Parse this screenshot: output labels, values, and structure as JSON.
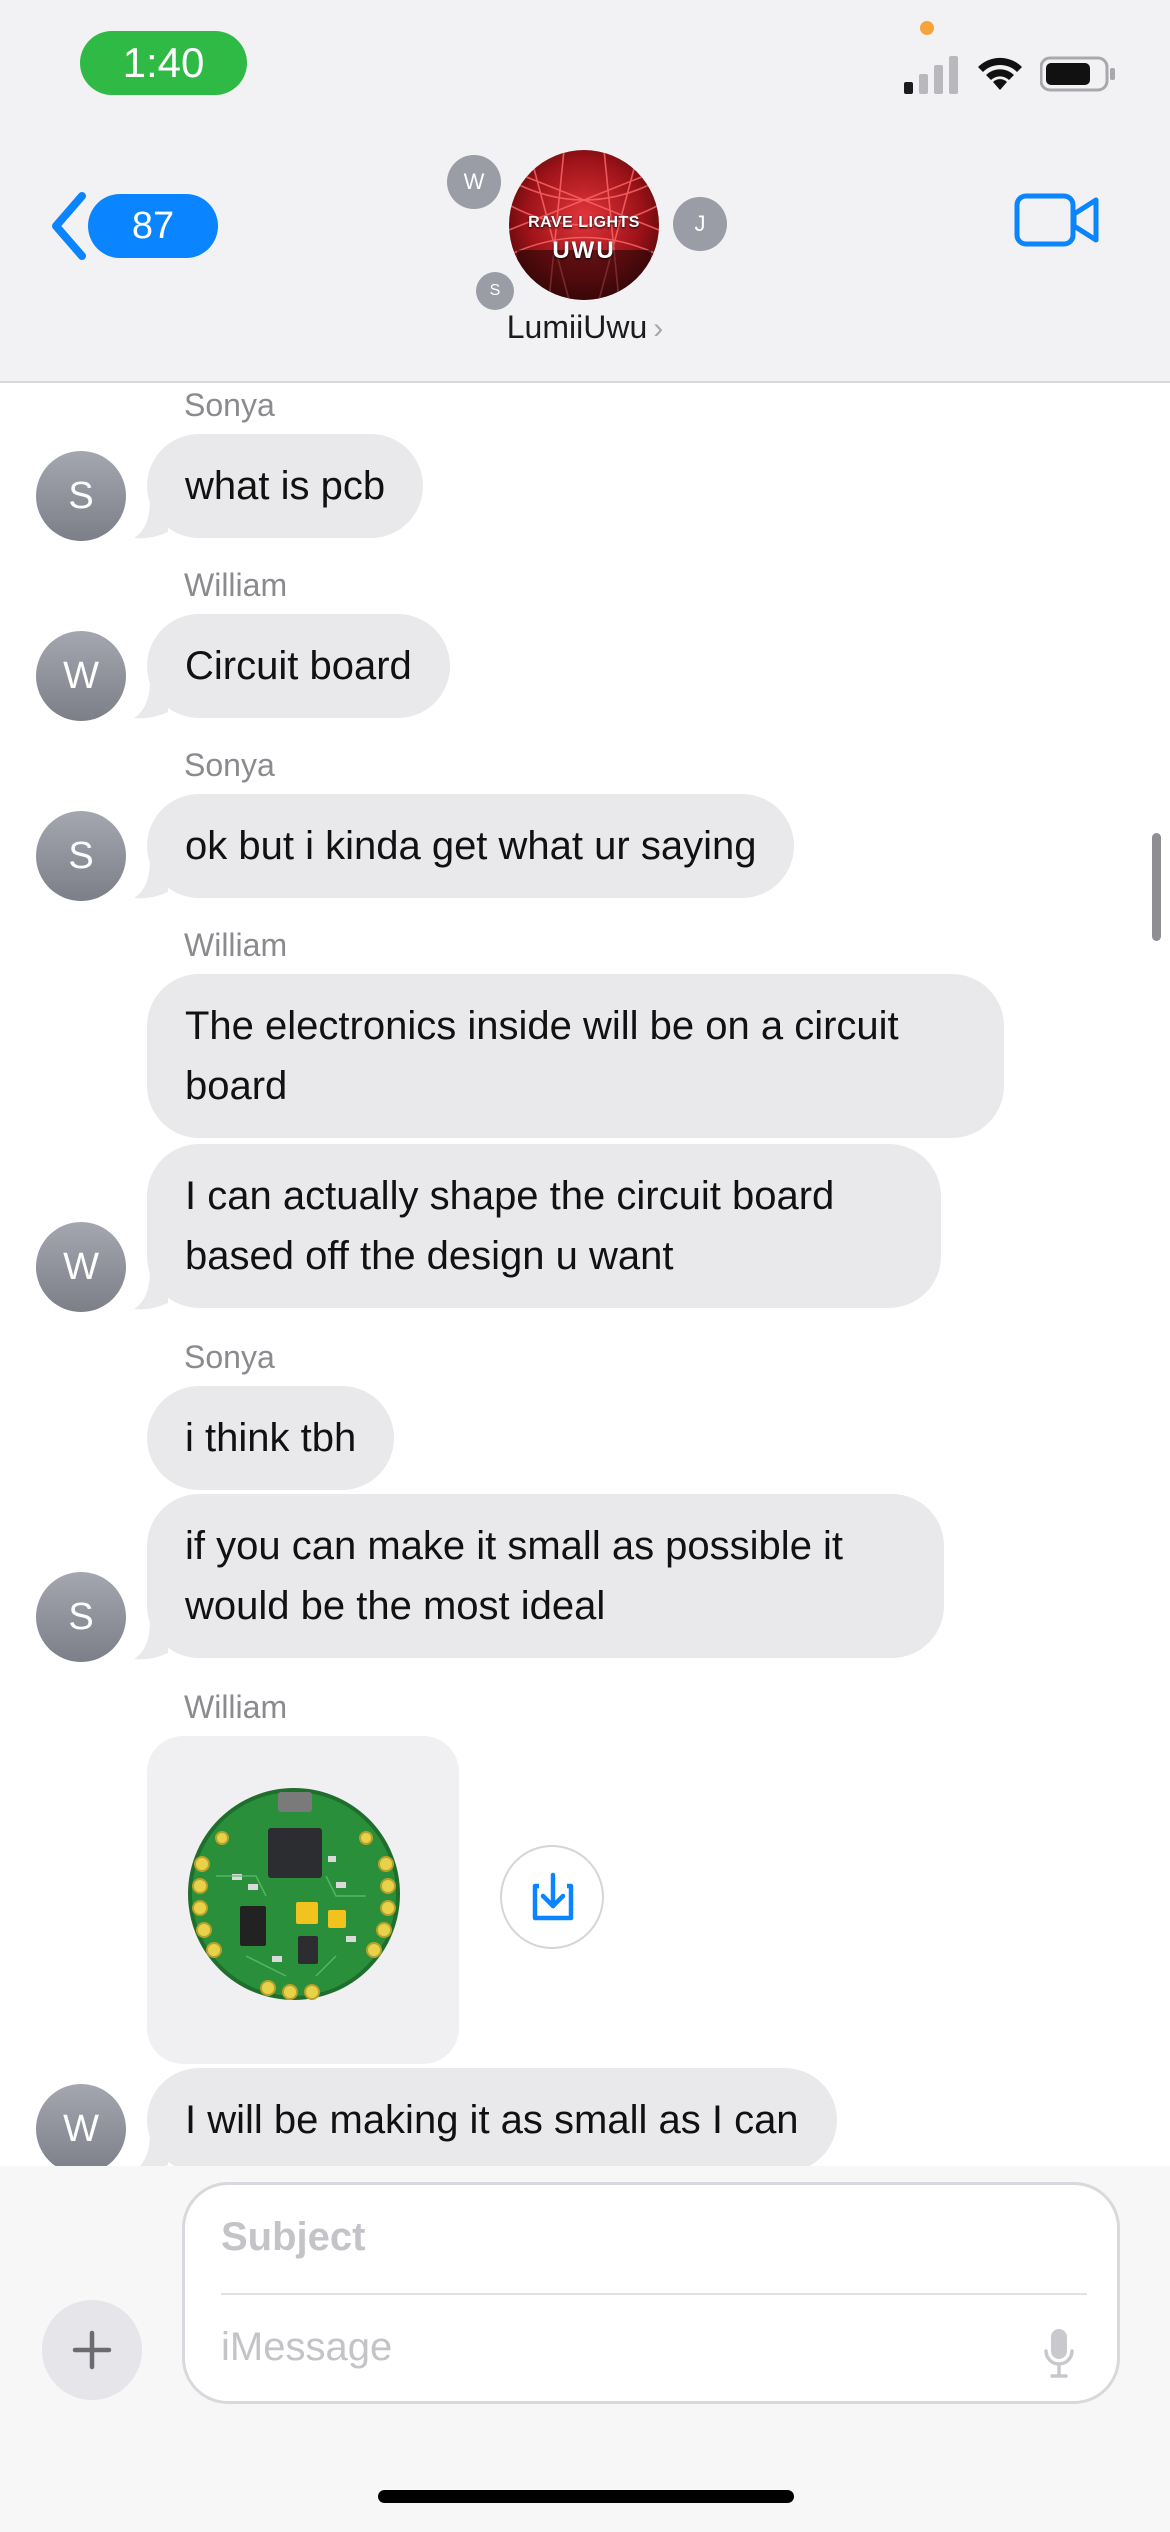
{
  "status_bar": {
    "time": "1:40"
  },
  "nav": {
    "back_count": "87",
    "group_name": "LumiiUwu",
    "group_avatar_text_line1": "RAVE LIGHTS",
    "group_avatar_text_line2": "UWU",
    "member_initials": [
      "W",
      "J",
      "S"
    ]
  },
  "messages": [
    {
      "sender": "Sonya",
      "initial": "S",
      "text": "what is pcb"
    },
    {
      "sender": "William",
      "initial": "W",
      "text": "Circuit board"
    },
    {
      "sender": "Sonya",
      "initial": "S",
      "text": "ok but i kinda get what ur saying"
    },
    {
      "sender": "William",
      "initial": "W",
      "text": "The electronics inside will be on a circuit board"
    },
    {
      "sender": "William",
      "initial": "W",
      "text": "I can actually shape the circuit board based off the design u want"
    },
    {
      "sender": "Sonya",
      "initial": "S",
      "text": "i think tbh"
    },
    {
      "sender": "Sonya",
      "initial": "S",
      "text": "if you can make it small as possible it would be the most ideal"
    },
    {
      "sender": "William",
      "initial": "W",
      "text": "I will be making it as small as I can"
    }
  ],
  "composer": {
    "subject_placeholder": "Subject",
    "message_placeholder": "iMessage"
  },
  "colors": {
    "accent": "#0a84ff",
    "bubble_gray": "#e9e9eb",
    "time_pill": "#2fba46"
  },
  "icons": [
    "signal-icon",
    "wifi-icon",
    "battery-icon",
    "chevron-left-icon",
    "video-camera-icon",
    "download-icon",
    "plus-icon",
    "microphone-icon"
  ]
}
